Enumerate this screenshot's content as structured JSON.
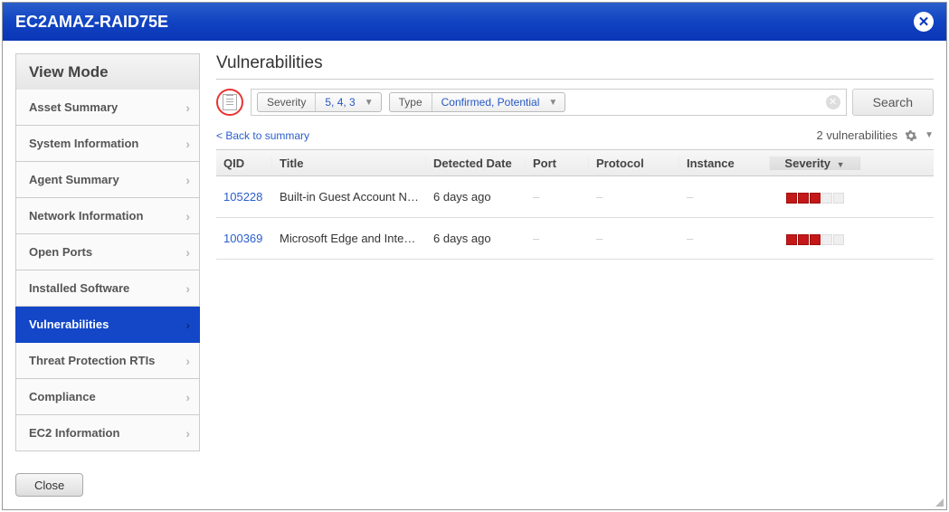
{
  "titlebar": {
    "title": "EC2AMAZ-RAID75E"
  },
  "sidebar": {
    "header": "View Mode",
    "items": [
      {
        "label": "Asset Summary"
      },
      {
        "label": "System Information"
      },
      {
        "label": "Agent Summary"
      },
      {
        "label": "Network Information"
      },
      {
        "label": "Open Ports"
      },
      {
        "label": "Installed Software"
      },
      {
        "label": "Vulnerabilities"
      },
      {
        "label": "Threat Protection RTIs"
      },
      {
        "label": "Compliance"
      },
      {
        "label": "EC2 Information"
      }
    ],
    "activeIndex": 6
  },
  "main": {
    "heading": "Vulnerabilities",
    "filters": {
      "severity_label": "Severity",
      "severity_value": "5, 4, 3",
      "type_label": "Type",
      "type_value": "Confirmed, Potential"
    },
    "search_label": "Search",
    "back_link": "< Back to summary",
    "count_text": "2 vulnerabilities",
    "columns": {
      "qid": "QID",
      "title": "Title",
      "date": "Detected Date",
      "port": "Port",
      "protocol": "Protocol",
      "instance": "Instance",
      "severity": "Severity"
    },
    "rows": [
      {
        "qid": "105228",
        "title": "Built-in Guest Account N…",
        "date": "6 days ago",
        "port": "–",
        "protocol": "–",
        "instance": "–",
        "severity": 3
      },
      {
        "qid": "100369",
        "title": "Microsoft Edge and Inter…",
        "date": "6 days ago",
        "port": "–",
        "protocol": "–",
        "instance": "–",
        "severity": 3
      }
    ]
  },
  "footer": {
    "close": "Close"
  }
}
